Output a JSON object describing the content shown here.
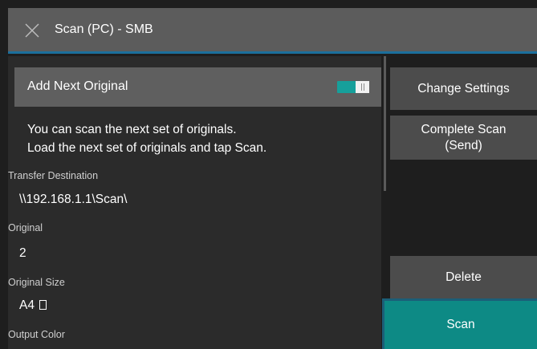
{
  "header": {
    "title": "Scan (PC) - SMB",
    "close_icon": "close-x-icon"
  },
  "add_next": {
    "label": "Add Next Original",
    "toggle_on": true
  },
  "message": {
    "line1": "You can scan the next set of originals.",
    "line2": "Load the next set of originals and tap Scan."
  },
  "fields": {
    "transfer_destination": {
      "label": "Transfer Destination",
      "value": "\\\\192.168.1.1\\Scan\\"
    },
    "original": {
      "label": "Original",
      "value": "2"
    },
    "original_size": {
      "label": "Original Size",
      "value": "A4",
      "orientation_icon": "portrait-paper-icon"
    },
    "output_color": {
      "label": "Output Color"
    }
  },
  "buttons": {
    "change_settings": "Change Settings",
    "complete_scan_line1": "Complete Scan",
    "complete_scan_line2": "(Send)",
    "delete": "Delete",
    "scan": "Scan"
  },
  "colors": {
    "accent": "#0d8a85",
    "toggle": "#16a09b",
    "header_border": "#1b6f9c"
  }
}
